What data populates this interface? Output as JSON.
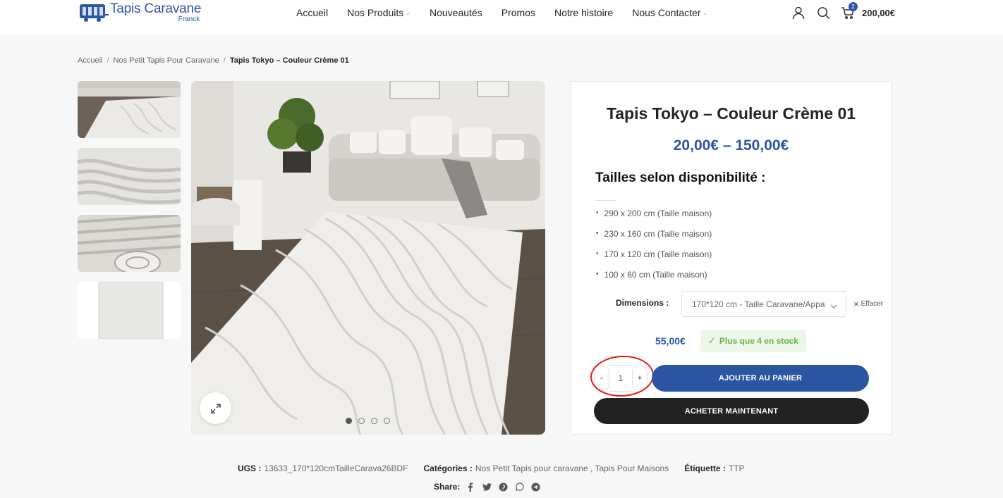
{
  "header": {
    "logo_title": "Tapis Caravane",
    "logo_sub": "Franck",
    "nav": [
      {
        "label": "Accueil",
        "has_caret": false
      },
      {
        "label": "Nos Produits",
        "has_caret": true
      },
      {
        "label": "Nouveautés",
        "has_caret": false
      },
      {
        "label": "Promos",
        "has_caret": false
      },
      {
        "label": "Notre histoire",
        "has_caret": false
      },
      {
        "label": "Nous Contacter",
        "has_caret": true
      }
    ],
    "cart_count": "2",
    "cart_total": "200,00€",
    "icons": [
      "user-icon",
      "search-icon",
      "cart-icon"
    ]
  },
  "breadcrumb": {
    "items": [
      "Accueil",
      "Nos Petit Tapis Pour Caravane"
    ],
    "separator": "/",
    "current": "Tapis Tokyo – Couleur Crème 01"
  },
  "gallery": {
    "thumbnails": [
      "Tapis Tokyo vue salon",
      "Détail motif vague",
      "Détail tapis roulé",
      "Vue de dessus"
    ],
    "slide_count": 4,
    "active_slide": 1
  },
  "product": {
    "title": "Tapis Tokyo – Couleur Crème 01",
    "price_range": "20,00€ – 150,00€",
    "sizes_heading": "Tailles selon disponibilité :",
    "sizes": [
      "290 x 200 cm (Taille maison)",
      "230 x 160 cm (Taille maison)",
      "170 x 120 cm (Taille maison)",
      "100 x 60 cm (Taille maison)"
    ],
    "dimensions_label": "Dimensions",
    "dimensions_selected": "170*120 cm - Taille Caravane/Appa",
    "clear_label": "Effacer",
    "variation_price": "55,00€",
    "stock_label": "Plus que 4 en stock",
    "quantity": "1",
    "qty_minus": "-",
    "qty_plus": "+",
    "add_to_cart": "AJOUTER AU PANIER",
    "buy_now": "ACHETER MAINTENANT"
  },
  "meta": {
    "sku_label": "UGS :",
    "sku": "13633_170*120cmTailleCarava26BDF",
    "categories_label": "Catégories :",
    "categories": "Nos Petit Tapis pour caravane , Tapis Pour Maisons",
    "tag_label": "Étiquette :",
    "tag": "TTP",
    "share_label": "Share:",
    "share_icons": [
      "facebook-icon",
      "twitter-icon",
      "pinterest-icon",
      "whatsapp-icon",
      "telegram-icon"
    ]
  },
  "colors": {
    "brand_blue": "#2c56a3",
    "buy_dark": "#222222",
    "stock_green": "#6bb04a",
    "annotation_red": "#e31b1b"
  }
}
